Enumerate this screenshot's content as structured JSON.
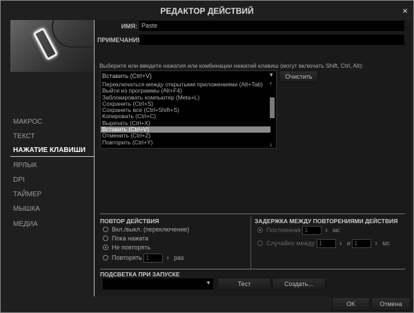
{
  "title": "РЕДАКТОР ДЕЙСТВИЙ",
  "close": "×",
  "nav": [
    "МАКРОС",
    "ТЕКСТ",
    "НАЖАТИЕ КЛАВИШИ",
    "ЯРЛЫК",
    "DPI",
    "ТАЙМЕР",
    "МЫШКА",
    "МЕДИА"
  ],
  "name_label": "ИМЯ:",
  "name_value": "Paste",
  "notes_label": "ПРИМЕЧАНИЯ:",
  "notes_value": "",
  "prompt": "Выберите или введите нажатия или комбинации нажатий клавиш (могут включать Shift, Ctrl, Alt):",
  "combo_value": "Вставить (Ctrl+V)",
  "clear": "Очистить",
  "items": [
    "Переключаться между открытыми приложениями (Alt+Tab)",
    "Выйти из программы (Alt+F4)",
    "Заблокировать компьютер (Meta+L)",
    "Сохранить (Ctrl+S)",
    "Сохранить все (Ctrl+Shift+S)",
    "Копировать (Ctrl+C)",
    "Вырезать (Ctrl+X)",
    "Вставить (Ctrl+V)",
    "Отменить (Ctrl+Z)",
    "Повторить (Ctrl+Y)"
  ],
  "repeat": {
    "title": "ПОВТОР ДЕЙСТВИЯ",
    "opts": [
      "Вкл./выкл. (переключение)",
      "Пока нажата",
      "Не повторять",
      "Повторять"
    ],
    "count": "1",
    "unit": "раз"
  },
  "delay": {
    "title": "ЗАДЕРЖКА МЕЖДУ ПОВТОРЕНИЯМИ ДЕЙСТВИЯ",
    "constant": "Постоянная",
    "const_val": "1",
    "ms": "мс",
    "random": "Случайно между",
    "from": "1",
    "and": "и",
    "to": "1"
  },
  "light": {
    "title": "ПОДСВЕТКА ПРИ ЗАПУСКЕ",
    "test": "Тест",
    "create": "Создать..."
  },
  "ok": "OK",
  "cancel": "Отмена"
}
